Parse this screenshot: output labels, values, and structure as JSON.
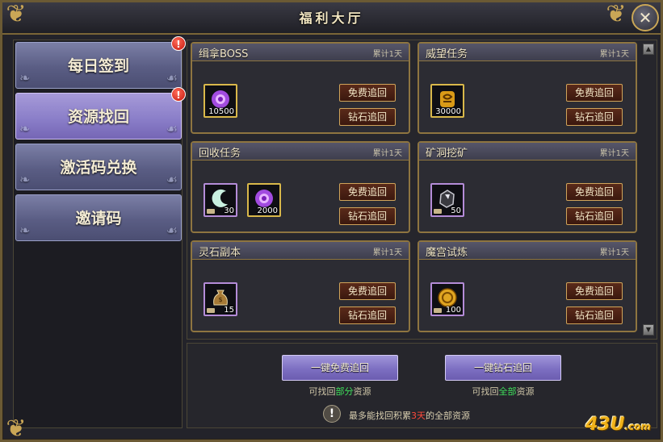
{
  "window": {
    "title": "福利大厅",
    "close": "✕"
  },
  "nav": [
    {
      "label": "每日签到",
      "badge": "!"
    },
    {
      "label": "资源找回",
      "badge": "!"
    },
    {
      "label": "激活码兑换"
    },
    {
      "label": "邀请码"
    }
  ],
  "cards": [
    {
      "name": "缉拿BOSS",
      "acc": "累计1天",
      "items": [
        {
          "count": "10500",
          "icon": "purple-orb-icon"
        }
      ],
      "free_btn": "免费追回",
      "diamond_btn": "钻石追回"
    },
    {
      "name": "威望任务",
      "acc": "累计1天",
      "items": [
        {
          "count": "30000",
          "icon": "gold-scroll-icon"
        }
      ],
      "free_btn": "免费追回",
      "diamond_btn": "钻石追回"
    },
    {
      "name": "回收任务",
      "acc": "累计1天",
      "items": [
        {
          "count": "30",
          "icon": "crescent-moon-icon"
        },
        {
          "count": "2000",
          "icon": "purple-orb-icon"
        }
      ],
      "free_btn": "免费追回",
      "diamond_btn": "钻石追回"
    },
    {
      "name": "矿洞挖矿",
      "acc": "累计1天",
      "items": [
        {
          "count": "50",
          "icon": "ore-icon"
        }
      ],
      "free_btn": "免费追回",
      "diamond_btn": "钻石追回"
    },
    {
      "name": "灵石副本",
      "acc": "累计1天",
      "items": [
        {
          "count": "15",
          "icon": "money-bag-icon"
        }
      ],
      "free_btn": "免费追回",
      "diamond_btn": "钻石追回"
    },
    {
      "name": "魔宫试炼",
      "acc": "累计1天",
      "items": [
        {
          "count": "100",
          "icon": "gold-coin-icon"
        }
      ],
      "free_btn": "免费追回",
      "diamond_btn": "钻石追回"
    }
  ],
  "bottom": {
    "free_all": "一键免费追回",
    "diamond_all": "一键钻石追回",
    "free_hint_pre": "可找回",
    "free_hint_hl": "部分",
    "free_hint_post": "资源",
    "diamond_hint_pre": "可找回",
    "diamond_hint_hl": "全部",
    "diamond_hint_post": "资源",
    "warn_pre": "最多能找回积累",
    "warn_hl": "3天",
    "warn_post": "的全部资源"
  },
  "logo": {
    "main": "43U",
    "suffix": ".com"
  },
  "colors": {
    "accent_gold": "#8e7540",
    "highlight_green": "#3fe05c",
    "warn_red": "#ff4a3a"
  }
}
